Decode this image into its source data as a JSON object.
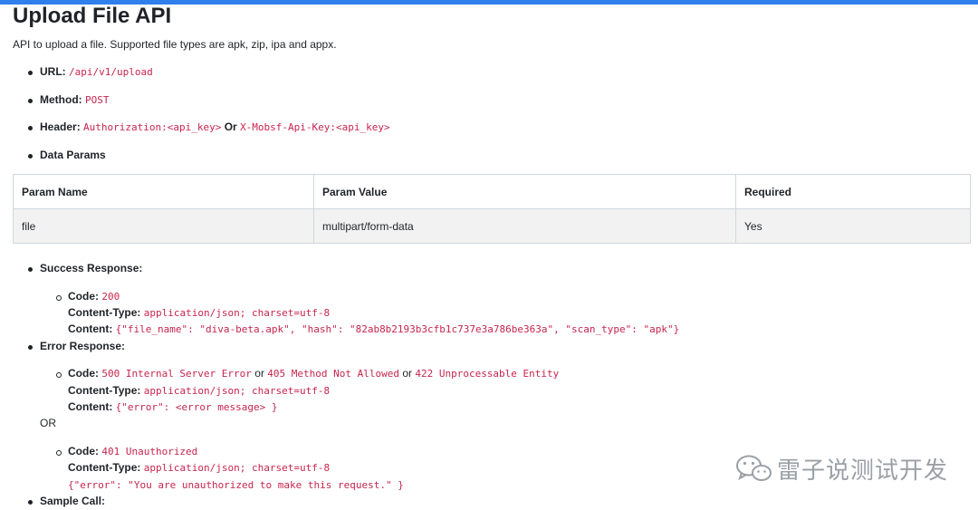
{
  "doc": {
    "title": "Upload File API",
    "intro": "API to upload a file. Supported file types are apk, zip, ipa and appx.",
    "url_label": "URL:",
    "url_value": "/api/v1/upload",
    "method_label": "Method:",
    "method_value": "POST",
    "header_label": "Header:",
    "header_value1": "Authorization:<api_key>",
    "header_or": "Or",
    "header_value2": "X-Mobsf-Api-Key:<api_key>",
    "data_params_label": "Data Params",
    "table": {
      "headers": [
        "Param Name",
        "Param Value",
        "Required"
      ],
      "rows": [
        [
          "file",
          "multipart/form-data",
          "Yes"
        ]
      ]
    },
    "success": {
      "label": "Success Response:",
      "code_label": "Code:",
      "code_value": "200",
      "ctype_label": "Content-Type:",
      "ctype_value": "application/json; charset=utf-8",
      "content_label": "Content:",
      "content_value": "{\"file_name\": \"diva-beta.apk\", \"hash\": \"82ab8b2193b3cfb1c737e3a786be363a\", \"scan_type\": \"apk\"}"
    },
    "error": {
      "label": "Error Response:",
      "code_label": "Code:",
      "code1": "500 Internal Server Error",
      "or1": "or",
      "code2": "405 Method Not Allowed",
      "or2": "or",
      "code3": "422 Unprocessable Entity",
      "ctype_label": "Content-Type:",
      "ctype_value": "application/json; charset=utf-8",
      "content_label": "Content:",
      "content_value": "{\"error\": <error message> }",
      "or_separator": "OR",
      "code_label_b": "Code:",
      "code4": "401 Unauthorized",
      "ctype_label_b": "Content-Type:",
      "ctype_value_b": "application/json; charset=utf-8",
      "content_value_b": "{\"error\": \"You are unauthorized to make this request.\" }"
    },
    "sample_call_label": "Sample Call:"
  },
  "watermark": {
    "text": "雷子说测试开发",
    "icon": "wechat-logo-icon"
  },
  "colors": {
    "accent_bar": "#2f80ed",
    "code_text": "#c7254e",
    "table_row_bg": "#f2f2f2"
  }
}
